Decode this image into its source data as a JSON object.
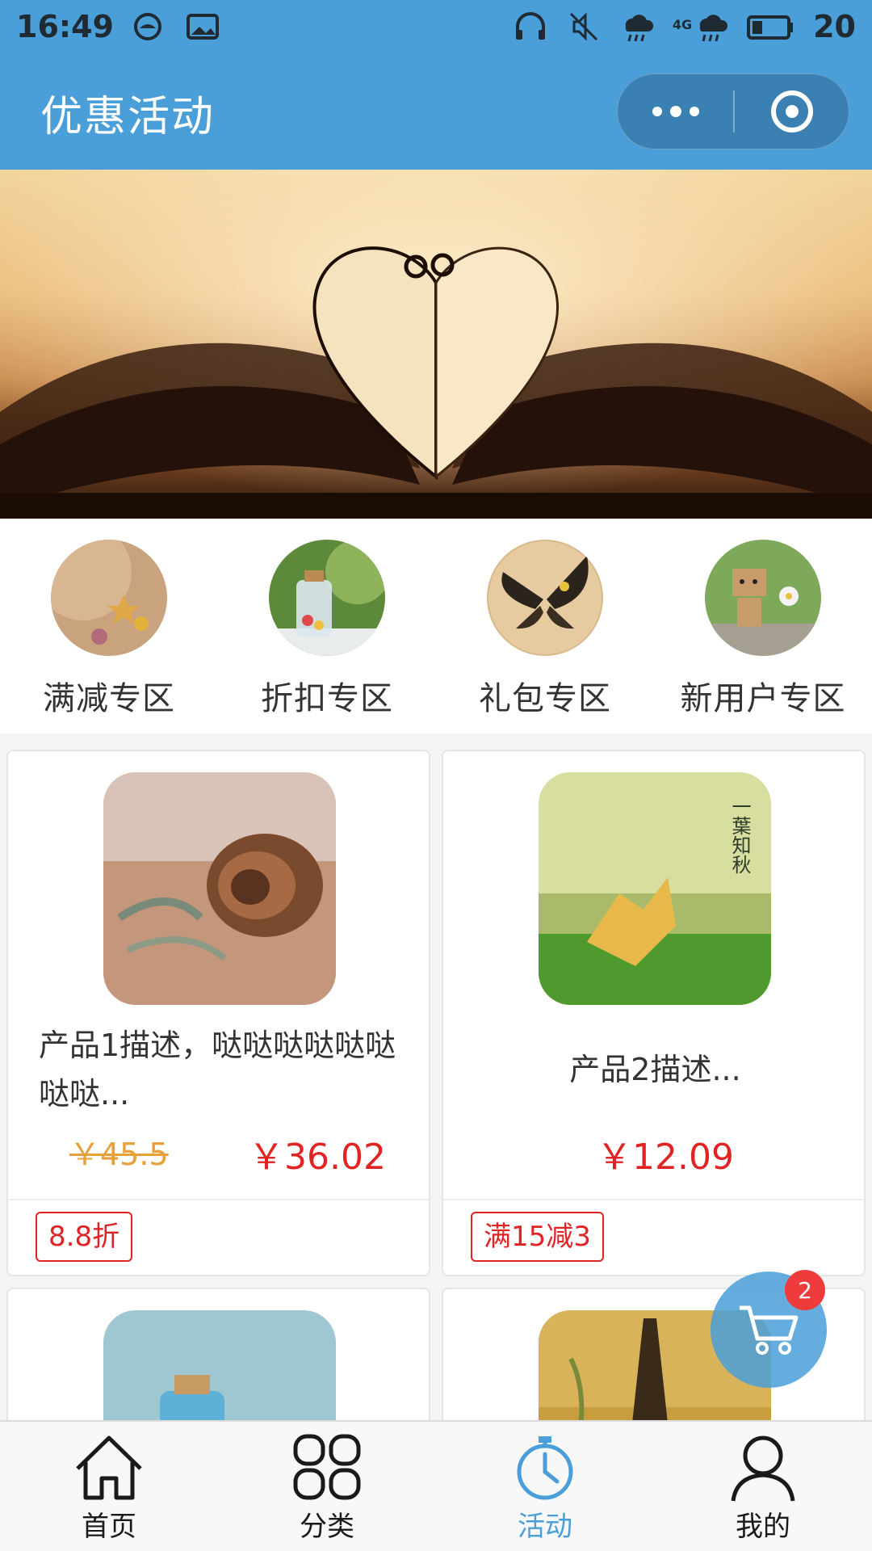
{
  "status_bar": {
    "time": "16:49",
    "battery": "20",
    "network": "4G"
  },
  "header": {
    "title": "优惠活动"
  },
  "categories": [
    {
      "label": "满减专区",
      "icon": "seashell-thumbnail"
    },
    {
      "label": "折扣专区",
      "icon": "bottle-thumbnail"
    },
    {
      "label": "礼包专区",
      "icon": "butterfly-thumbnail"
    },
    {
      "label": "新用户专区",
      "icon": "robot-figure-thumbnail"
    }
  ],
  "products": [
    {
      "desc": "产品1描述，哒哒哒哒哒哒哒哒...",
      "old_price": "￥45.5",
      "price": "￥36.02",
      "tag": "8.8折"
    },
    {
      "desc": "产品2描述...",
      "price": "￥12.09",
      "tag": "满15减3",
      "image_text": "一葉知秋"
    }
  ],
  "cart": {
    "badge": "2"
  },
  "tabs": [
    {
      "label": "首页",
      "icon": "home-icon"
    },
    {
      "label": "分类",
      "icon": "category-grid-icon"
    },
    {
      "label": "活动",
      "icon": "stopwatch-icon",
      "active": true
    },
    {
      "label": "我的",
      "icon": "user-icon"
    }
  ],
  "colors": {
    "primary": "#4a9fd8",
    "price_red": "#e02424",
    "old_price_orange": "#e8a13a"
  }
}
